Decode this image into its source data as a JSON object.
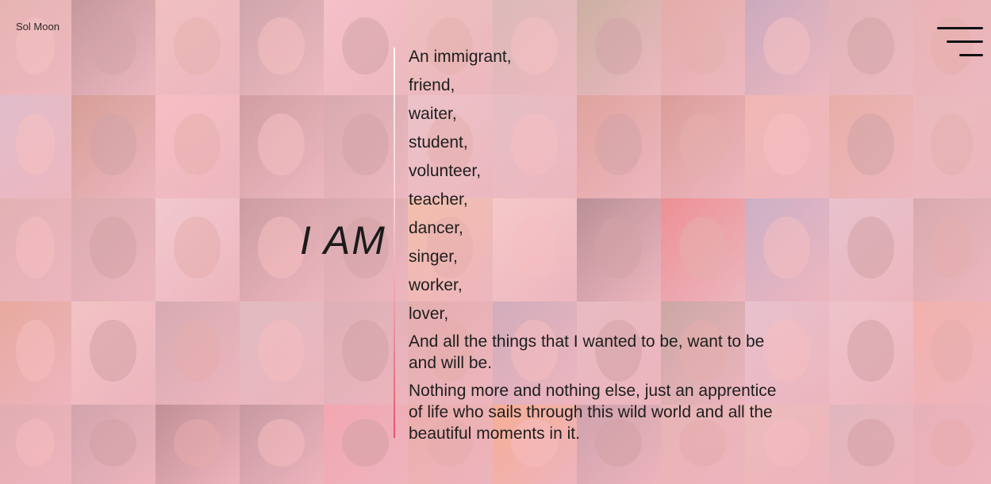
{
  "brand": {
    "name": "Sol Moon"
  },
  "menu": {
    "icon": "hamburger-menu-icon"
  },
  "hero": {
    "heading": "I AM",
    "roles": [
      "An immigrant,",
      "friend,",
      "waiter,",
      "student,",
      "volunteer,",
      "teacher,",
      "dancer,",
      "singer,",
      "worker,",
      "lover,"
    ],
    "paragraph_1": "And all the things that I wanted to be, want to be and will be.",
    "paragraph_2": "Nothing more and nothing else, just an apprentice of life who sails through this wild world and all the beautiful moments in it."
  },
  "colors": {
    "overlay": "#f5b4c3",
    "divider_top": "#ffffff",
    "divider_bottom": "#e3556b",
    "text": "#1e1e1e"
  },
  "mosaic": {
    "tiles": [
      "#c9a38a",
      "#6d5a52",
      "#e3c3b0",
      "#8a7e78",
      "#f2c6c8",
      "#d9c2a6",
      "#a9b39a",
      "#7f9a5f",
      "#c08e72",
      "#7c8aa8",
      "#b7a59c",
      "#d1a18f",
      "#b9c0cf",
      "#9a6c3d",
      "#f2c5ba",
      "#8c6f62",
      "#9f8d84",
      "#d8d0c8",
      "#c9c3be",
      "#b57a52",
      "#a86a48",
      "#e0b090",
      "#cc9a6c",
      "#cfb6a8",
      "#bca391",
      "#a59386",
      "#e8e2dc",
      "#7c6a5e",
      "#9d8f82",
      "#e9c77a",
      "#f0e4c8",
      "#4d4745",
      "#d9483a",
      "#7fa0c5",
      "#c8d0d4",
      "#9e8f86",
      "#c98f56",
      "#e6d7c0",
      "#9a9490",
      "#b4c2b6",
      "#a9a29b",
      "#c19f87",
      "#8a9aaa",
      "#c7c0ba",
      "#7a8a6a",
      "#c7d3db",
      "#dcd8d2",
      "#e6a87c",
      "#b8a08e",
      "#8a8480",
      "#5c4a40",
      "#6c6562",
      "#e68d8f",
      "#d6a17c",
      "#f2a23c",
      "#7f7f7f",
      "#c8b29a",
      "#d7c7a6",
      "#b3b8b0",
      "#c9a6a0"
    ]
  }
}
